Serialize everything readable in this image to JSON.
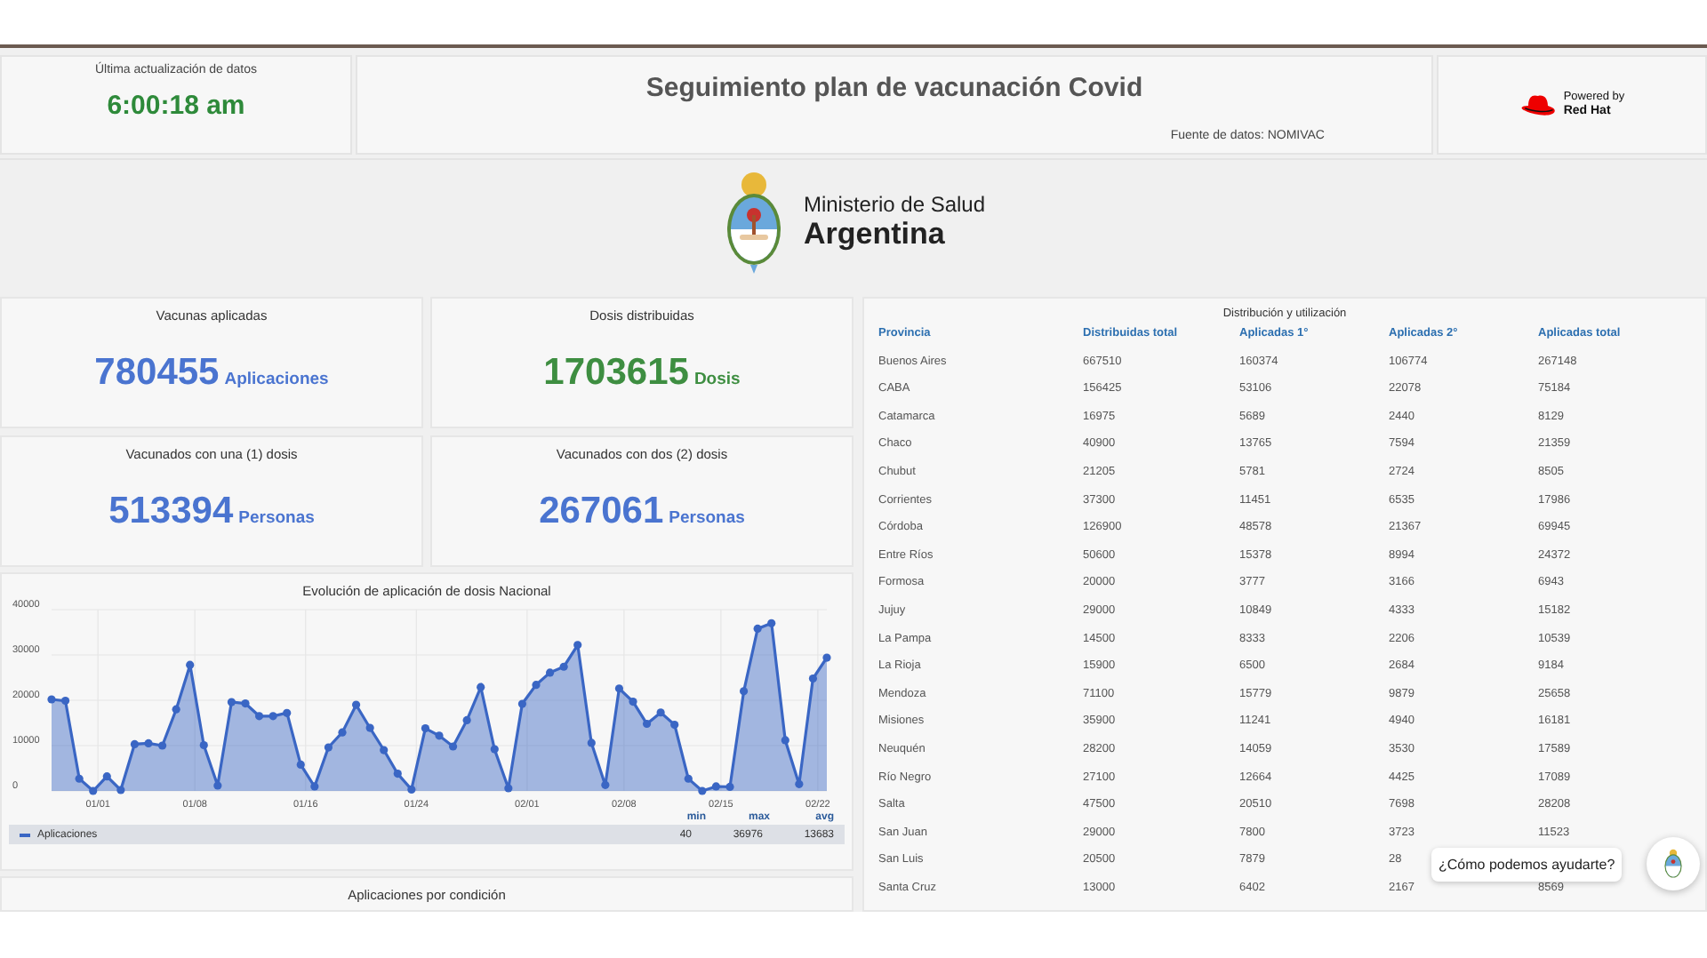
{
  "header": {
    "update_label": "Última actualización de datos",
    "update_time": "6:00:18 am",
    "title": "Seguimiento plan de vacunación Covid",
    "source": "Fuente de datos: NOMIVAC",
    "powered_by": "Powered by",
    "brand": "Red Hat"
  },
  "ministry": {
    "line1": "Ministerio de Salud",
    "line2": "Argentina"
  },
  "kpis": [
    {
      "title": "Vacunas aplicadas",
      "value": "780455",
      "unit": "Aplicaciones",
      "color": "#4a74d0"
    },
    {
      "title": "Dosis distribuidas",
      "value": "1703615",
      "unit": "Dosis",
      "color": "#3e8e41"
    },
    {
      "title": "Vacunados con una (1) dosis",
      "value": "513394",
      "unit": "Personas",
      "color": "#4a74d0"
    },
    {
      "title": "Vacunados con dos (2) dosis",
      "value": "267061",
      "unit": "Personas",
      "color": "#4a74d0"
    }
  ],
  "chart": {
    "title": "Evolución de aplicación de dosis Nacional",
    "chart_data": {
      "type": "area",
      "grid": true,
      "ylim": [
        0,
        40000
      ],
      "yticks": [
        0,
        10000,
        20000,
        30000,
        40000
      ],
      "categories": [
        null,
        null,
        null,
        "01/01",
        null,
        null,
        null,
        null,
        null,
        null,
        "01/08",
        null,
        null,
        null,
        null,
        null,
        null,
        null,
        "01/16",
        null,
        null,
        null,
        null,
        null,
        null,
        null,
        "01/24",
        null,
        null,
        null,
        null,
        null,
        null,
        null,
        "02/01",
        null,
        null,
        null,
        null,
        null,
        null,
        "02/08",
        null,
        null,
        null,
        null,
        null,
        null,
        "02/15",
        null,
        null,
        null,
        null,
        null,
        null,
        "02/22",
        null
      ],
      "series": [
        {
          "name": "Aplicaciones",
          "color": "#3a66c4",
          "values": [
            20200,
            19900,
            2700,
            0,
            3200,
            200,
            10300,
            10500,
            10000,
            18000,
            27800,
            10100,
            1200,
            19600,
            19300,
            16500,
            16500,
            17200,
            5800,
            1000,
            9600,
            12900,
            19000,
            13900,
            9000,
            3800,
            300,
            13800,
            12200,
            9800,
            15600,
            22900,
            9200,
            600,
            19200,
            23400,
            26100,
            27400,
            32200,
            10600,
            1300,
            22600,
            19700,
            14800,
            17300,
            14600,
            2700,
            0,
            1000,
            900,
            22000,
            35800,
            37000,
            11200,
            1500,
            24800,
            29400
          ]
        }
      ]
    },
    "legend": {
      "min_label": "min",
      "max_label": "max",
      "avg_label": "avg",
      "min": "40",
      "max": "36976",
      "avg": "13683"
    }
  },
  "condition_panel": {
    "title": "Aplicaciones por condición"
  },
  "table": {
    "title": "Distribución y utilización",
    "columns": [
      "Provincia",
      "Distribuidas total",
      "Aplicadas 1°",
      "Aplicadas 2°",
      "Aplicadas total"
    ],
    "rows": [
      [
        "Buenos Aires",
        "667510",
        "160374",
        "106774",
        "267148"
      ],
      [
        "CABA",
        "156425",
        "53106",
        "22078",
        "75184"
      ],
      [
        "Catamarca",
        "16975",
        "5689",
        "2440",
        "8129"
      ],
      [
        "Chaco",
        "40900",
        "13765",
        "7594",
        "21359"
      ],
      [
        "Chubut",
        "21205",
        "5781",
        "2724",
        "8505"
      ],
      [
        "Corrientes",
        "37300",
        "11451",
        "6535",
        "17986"
      ],
      [
        "Córdoba",
        "126900",
        "48578",
        "21367",
        "69945"
      ],
      [
        "Entre Ríos",
        "50600",
        "15378",
        "8994",
        "24372"
      ],
      [
        "Formosa",
        "20000",
        "3777",
        "3166",
        "6943"
      ],
      [
        "Jujuy",
        "29000",
        "10849",
        "4333",
        "15182"
      ],
      [
        "La Pampa",
        "14500",
        "8333",
        "2206",
        "10539"
      ],
      [
        "La Rioja",
        "15900",
        "6500",
        "2684",
        "9184"
      ],
      [
        "Mendoza",
        "71100",
        "15779",
        "9879",
        "25658"
      ],
      [
        "Misiones",
        "35900",
        "11241",
        "4940",
        "16181"
      ],
      [
        "Neuquén",
        "28200",
        "14059",
        "3530",
        "17589"
      ],
      [
        "Río Negro",
        "27100",
        "12664",
        "4425",
        "17089"
      ],
      [
        "Salta",
        "47500",
        "20510",
        "7698",
        "28208"
      ],
      [
        "San Juan",
        "29000",
        "7800",
        "3723",
        "11523"
      ],
      [
        "San Luis",
        "20500",
        "7879",
        "28"
      ],
      [
        "Santa Cruz",
        "13000",
        "6402",
        "2167",
        "8569"
      ]
    ]
  },
  "chat": {
    "prompt": "¿Cómo podemos ayudarte?"
  }
}
